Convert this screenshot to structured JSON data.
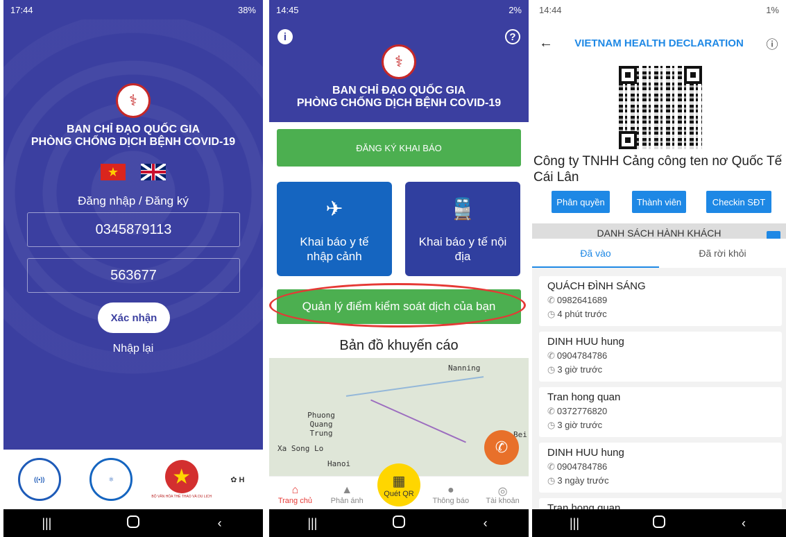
{
  "p1": {
    "status_time": "17:44",
    "status_right": "38%",
    "org_line1": "BAN CHỈ ĐẠO QUỐC GIA",
    "org_line2": "PHÒNG CHỐNG DỊCH BỆNH COVID-19",
    "login_label": "Đăng nhập / Đăng ký",
    "phone_value": "0345879113",
    "otp_value": "563677",
    "confirm_label": "Xác nhận",
    "reenter_label": "Nhập lại"
  },
  "p2": {
    "status_time": "14:45",
    "status_right": "2%",
    "org_line1": "BAN CHỈ ĐẠO QUỐC GIA",
    "org_line2": "PHÒNG CHỐNG DỊCH BỆNH COVID-19",
    "register_label": "ĐĂNG KÝ KHAI BÁO",
    "card_entry": "Khai báo y tế nhập cảnh",
    "card_domestic": "Khai báo y tế nội địa",
    "manage_label": "Quản lý điểm kiểm soát dịch của bạn",
    "map_title": "Bản đồ khuyến cáo",
    "map_labels": [
      "Nanning",
      "Phuong Quang Trung",
      "Xa Song Lo",
      "Hanoi",
      "Bei"
    ],
    "tabs": [
      "Trang chủ",
      "Phản ánh",
      "Quét QR",
      "Thông báo",
      "Tài khoản"
    ]
  },
  "p3": {
    "status_time": "14:44",
    "status_right": "1%",
    "title": "VIETNAM HEALTH DECLARATION",
    "company": "Công ty TNHH Cảng công ten nơ Quốc Tế Cái Lân",
    "btn_permissions": "Phân quyền",
    "btn_members": "Thành viên",
    "btn_checkin": "Checkin SĐT",
    "list_header": "DANH SÁCH HÀNH KHÁCH",
    "tab_in": "Đã vào",
    "tab_out": "Đã rời khỏi",
    "passengers": [
      {
        "name": "QUÁCH ĐÌNH SÁNG",
        "phone": "0982641689",
        "time": "4 phút trước"
      },
      {
        "name": "DINH HUU hung",
        "phone": "0904784786",
        "time": "3 giờ trước"
      },
      {
        "name": "Tran hong quan",
        "phone": "0372776820",
        "time": "3 giờ trước"
      },
      {
        "name": "DINH HUU hung",
        "phone": "0904784786",
        "time": "3 ngày trước"
      },
      {
        "name": "Tran hong quan",
        "phone": "",
        "time": ""
      }
    ]
  },
  "colors": {
    "primary": "#3b3fa0",
    "green": "#4caf50",
    "blue": "#1e88e5",
    "highlight": "#e53935"
  }
}
